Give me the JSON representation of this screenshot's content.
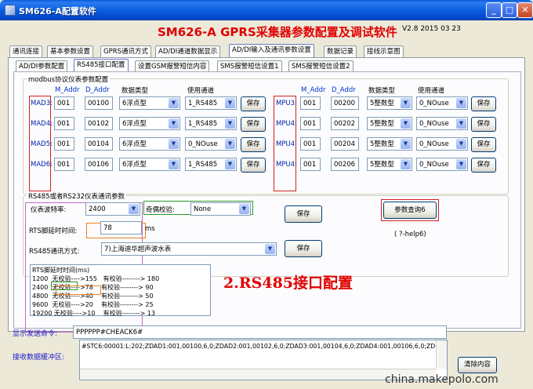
{
  "window": {
    "title": "SM626-A配置软件",
    "buttons": {
      "minimize": "_",
      "maximize": "□",
      "close": "✕"
    }
  },
  "header": {
    "title": "SM626-A GPRS采集器参数配置及调试软件",
    "version": "V2.8 2015 03 23"
  },
  "main_tabs": [
    "通讯连接",
    "基本参数设置",
    "GPRS通讯方式",
    "AD/DI通道数据显示",
    "AD/DI输入及通讯参数设置",
    "数据记录",
    "接线示意图"
  ],
  "sub_tabs": [
    "AD/DI参数配置",
    "RS485接口配置",
    "设置GSM报警短信内容",
    "SMS报警短信设置1",
    "SMS报警短信设置2"
  ],
  "modbus": {
    "group_label": "modbus协议仪表参数配置",
    "headers": {
      "m_addr": "M_Addr",
      "d_addr": "D_Addr",
      "data_type": "数据类型",
      "channel": "使用通道"
    },
    "save_label": "保存",
    "left_rows": [
      {
        "name": "MAD3:",
        "m_addr": "001",
        "d_addr": "00100",
        "type": "6浮点型",
        "channel": "1_RS485"
      },
      {
        "name": "MAD4:",
        "m_addr": "001",
        "d_addr": "00102",
        "type": "6浮点型",
        "channel": "1_RS485"
      },
      {
        "name": "MAD5:",
        "m_addr": "001",
        "d_addr": "00104",
        "type": "6浮点型",
        "channel": "0_NOuse"
      },
      {
        "name": "MAD6:",
        "m_addr": "001",
        "d_addr": "00106",
        "type": "6浮点型",
        "channel": "1_RS485"
      }
    ],
    "right_rows": [
      {
        "name": "MPU3:",
        "m_addr": "001",
        "d_addr": "00200",
        "type": "5整数型",
        "channel": "0_NOuse"
      },
      {
        "name": "MPU4:",
        "m_addr": "001",
        "d_addr": "00202",
        "type": "5整数型",
        "channel": "0_NOuse"
      },
      {
        "name": "MPU4:",
        "m_addr": "001",
        "d_addr": "00204",
        "type": "5整数型",
        "channel": "0_NOuse"
      },
      {
        "name": "MPU4:",
        "m_addr": "001",
        "d_addr": "00206",
        "type": "5整数型",
        "channel": "0_NOuse"
      }
    ]
  },
  "comm": {
    "group_label": "RS485或者RS232仪表通讯参数",
    "baud_label": "仪表波特率:",
    "baud_value": "2400",
    "parity_label": "奇偶校验:",
    "parity_value": "None",
    "rts_label": "RTS脚延时时间:",
    "rts_value": "78",
    "rts_unit": "ms",
    "mode_label": "RS485通讯方式:",
    "mode_value": "7)上海迪华超声波水表",
    "save_label": "保存",
    "query_label": "参数查询6",
    "help_text": "( ?-help6)"
  },
  "rts_table": {
    "lines": [
      "RTS脚延时时间(ms)",
      "1200  无校验---->155   有校验--------> 180",
      "2400  无校验---->78    有校验--------> 90",
      "4800  无校验---->40    有校验--------> 50",
      "9600  无校验---->20    有校验--------> 25",
      "19200 无校验---->10    有校验--------> 13"
    ]
  },
  "annotation": "2.RS485接口配置",
  "bottom": {
    "send_label": "显示发送命令:",
    "send_value": "PPPPPP#CHEACK6#",
    "recv_label": "接收数据缓冲区:",
    "recv_value": "#STC6:00001:L:202;ZDAD1:001,00100,6,0;ZDAD2:001,00102,6,0;ZDAD3:001,00104,6,0;ZDAD4:001,00106,6,0;ZDI",
    "clear_label": "清除内容"
  },
  "watermark": "china.makepolo.com",
  "colors": {
    "accent_red": "#e00000",
    "titlebar_blue": "#0b5ee0",
    "label_blue": "#0022aa"
  }
}
